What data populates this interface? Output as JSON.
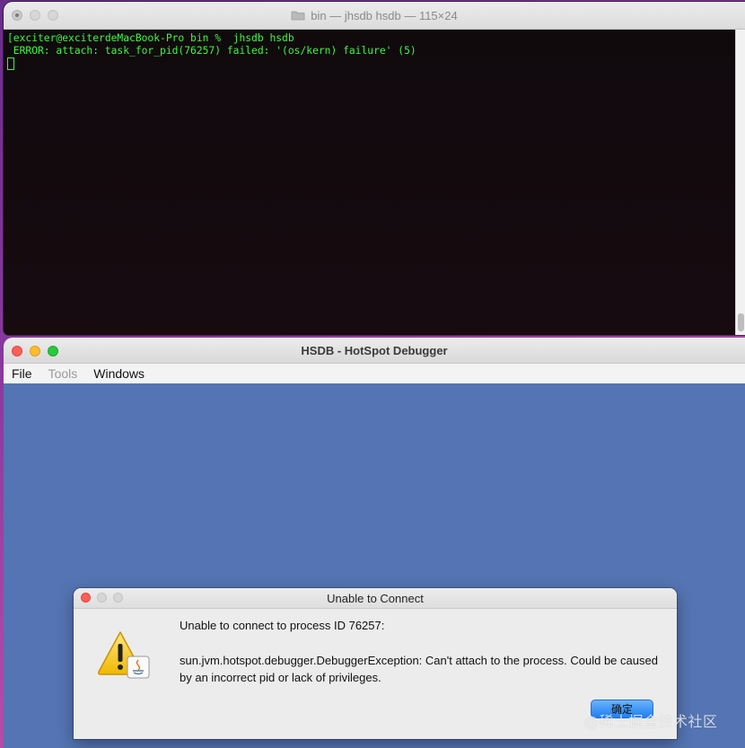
{
  "terminal": {
    "title": "bin — jhsdb hsdb — 115×24",
    "icons": [
      "folder-icon"
    ],
    "lines": [
      "[exciter@exciterdeMacBook-Pro bin %  jhsdb hsdb",
      " ERROR: attach: task_for_pid(76257) failed: '(os/kern) failure' (5)"
    ],
    "text_color": "#3df83d",
    "background": "#0f080c"
  },
  "hsdb": {
    "title": "HSDB - HotSpot Debugger",
    "menu": {
      "file": "File",
      "tools": "Tools",
      "windows": "Windows"
    },
    "desktop_color": "#5474b3"
  },
  "dialog": {
    "title": "Unable to Connect",
    "message_line1": "Unable to connect to process ID 76257:",
    "message_line2": "sun.jvm.hotspot.debugger.DebuggerException: Can't attach to the process. Could be caused by an incorrect pid or lack of privileges.",
    "ok_label": "确定",
    "icon": "warning-java-icon",
    "button_color": "#1d7ff3"
  },
  "watermark": "@稀土掘金技术社区"
}
